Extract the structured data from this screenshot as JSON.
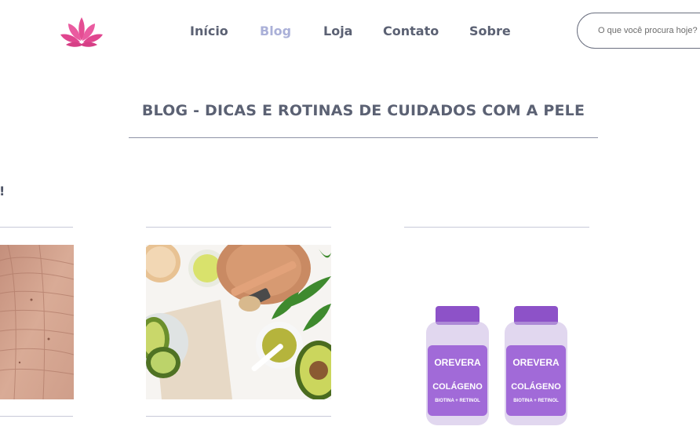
{
  "header": {
    "logo_icon": "lotus-logo-icon",
    "nav": [
      {
        "label": "Início",
        "active": false
      },
      {
        "label": "Blog",
        "active": true
      },
      {
        "label": "Loja",
        "active": false
      },
      {
        "label": "Contato",
        "active": false
      },
      {
        "label": "Sobre",
        "active": false
      }
    ],
    "search": {
      "placeholder": "O que você procura hoje?"
    }
  },
  "main": {
    "page_title": "BLOG - DICAS E ROTINAS DE CUIDADOS COM A PELE",
    "section_heading": "o!",
    "cards": [
      {
        "image": "wrinkled-skin-photo"
      },
      {
        "image": "avocado-skincare-ingredients-photo"
      },
      {
        "image": "orevera-collagen-bottles-photo",
        "product": {
          "brand": "OREVERA",
          "name": "COLÁGENO",
          "subtitle": "BIOTINA + RETINOL"
        }
      }
    ]
  },
  "colors": {
    "text": "#5b6173",
    "nav_active": "#aab0d8",
    "logo": "#e0468f",
    "bottle_purple": "#8d52c8"
  }
}
